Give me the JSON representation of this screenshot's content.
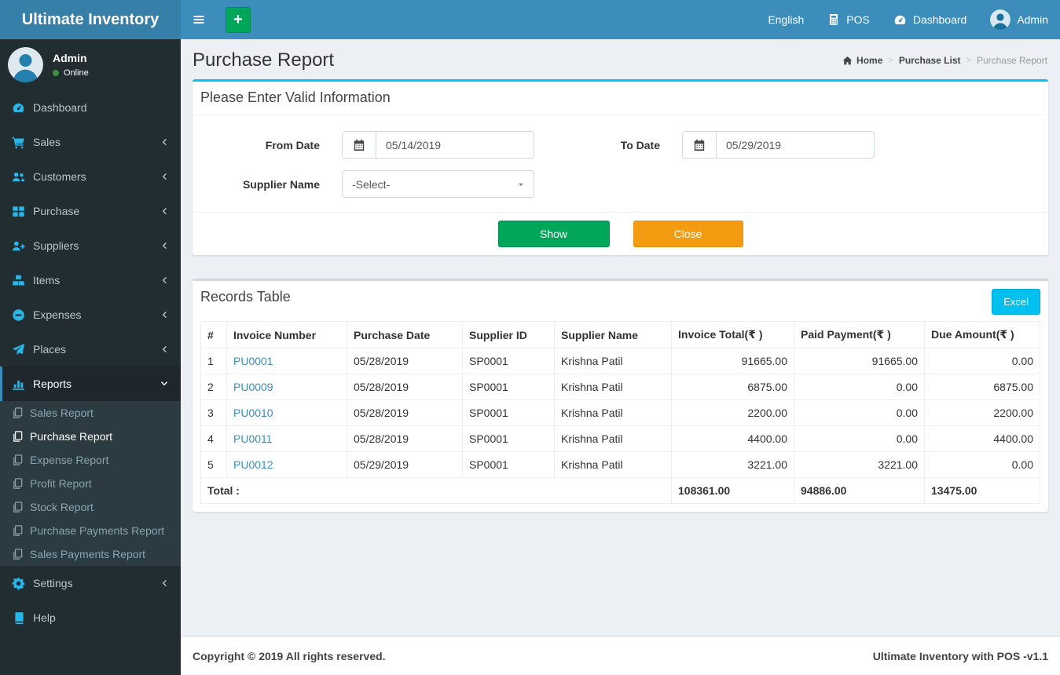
{
  "colors": {
    "navbar": "#3c8dbc",
    "logo_bg": "#367fa9",
    "sidebar_bg": "#222d32",
    "submenu_bg": "#2c3b41",
    "sidebar_icon": "#29b6e8",
    "info_cyan": "#00c0ef",
    "success_green": "#00a65a",
    "warning_orange": "#f39c12",
    "link_blue": "#3c8dbc",
    "online_dot": "#3f903f"
  },
  "topbar": {
    "brand": "Ultimate Inventory",
    "add_label": "+",
    "nav": {
      "language": "English",
      "pos": "POS",
      "dashboard": "Dashboard",
      "user": "Admin"
    }
  },
  "sidebar": {
    "user": {
      "name": "Admin",
      "status": "Online"
    },
    "menu": [
      {
        "label": "Dashboard"
      },
      {
        "label": "Sales"
      },
      {
        "label": "Customers"
      },
      {
        "label": "Purchase"
      },
      {
        "label": "Suppliers"
      },
      {
        "label": "Items"
      },
      {
        "label": "Expenses"
      },
      {
        "label": "Places"
      },
      {
        "label": "Reports"
      },
      {
        "label": "Settings"
      },
      {
        "label": "Help"
      }
    ],
    "submenu": [
      {
        "label": "Sales Report"
      },
      {
        "label": "Purchase Report"
      },
      {
        "label": "Expense Report"
      },
      {
        "label": "Profit Report"
      },
      {
        "label": "Stock Report"
      },
      {
        "label": "Purchase Payments Report"
      },
      {
        "label": "Sales Payments Report"
      }
    ]
  },
  "page": {
    "title": "Purchase Report",
    "breadcrumb": {
      "home": "Home",
      "parent": "Purchase List",
      "current": "Purchase Report"
    }
  },
  "filter": {
    "title": "Please Enter Valid Information",
    "from_label": "From Date",
    "from_value": "05/14/2019",
    "to_label": "To Date",
    "to_value": "05/29/2019",
    "supplier_label": "Supplier Name",
    "supplier_value": "-Select-",
    "show_label": "Show",
    "close_label": "Close"
  },
  "records": {
    "title": "Records Table",
    "excel_label": "Excel",
    "columns": [
      "#",
      "Invoice Number",
      "Purchase Date",
      "Supplier ID",
      "Supplier Name",
      "Invoice Total(₹ )",
      "Paid Payment(₹ )",
      "Due Amount(₹ )"
    ],
    "rows": [
      [
        "1",
        "PU0001",
        "05/28/2019",
        "SP0001",
        "Krishna Patil",
        "91665.00",
        "91665.00",
        "0.00"
      ],
      [
        "2",
        "PU0009",
        "05/28/2019",
        "SP0001",
        "Krishna Patil",
        "6875.00",
        "0.00",
        "6875.00"
      ],
      [
        "3",
        "PU0010",
        "05/28/2019",
        "SP0001",
        "Krishna Patil",
        "2200.00",
        "0.00",
        "2200.00"
      ],
      [
        "4",
        "PU0011",
        "05/28/2019",
        "SP0001",
        "Krishna Patil",
        "4400.00",
        "0.00",
        "4400.00"
      ],
      [
        "5",
        "PU0012",
        "05/29/2019",
        "SP0001",
        "Krishna Patil",
        "3221.00",
        "3221.00",
        "0.00"
      ]
    ],
    "total": {
      "label": "Total :",
      "invoice_total": "108361.00",
      "paid": "94886.00",
      "due": "13475.00"
    }
  },
  "footer": {
    "left": "Copyright © 2019 All rights reserved.",
    "right": "Ultimate Inventory with POS -v1.1"
  }
}
